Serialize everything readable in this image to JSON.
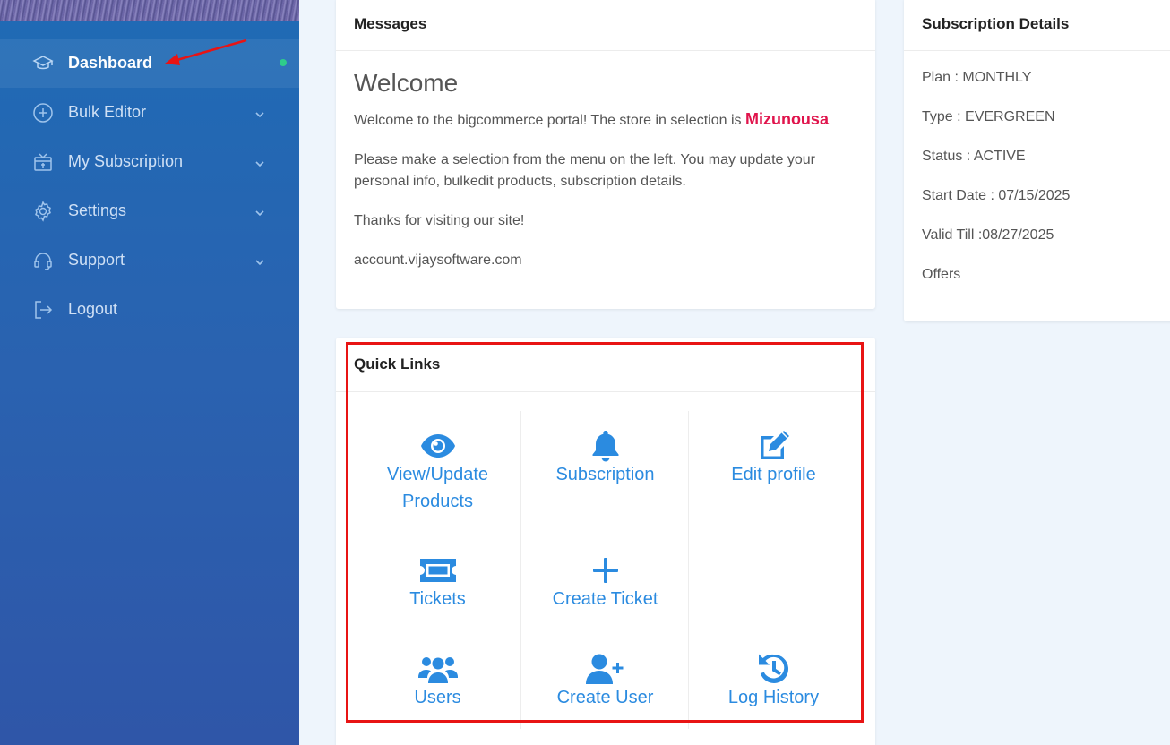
{
  "sidebar": {
    "items": [
      {
        "label": "Dashboard",
        "icon": "graduation-cap-icon",
        "active": true
      },
      {
        "label": "Bulk Editor",
        "icon": "plus-circle-icon"
      },
      {
        "label": "My Subscription",
        "icon": "subscription-box-icon"
      },
      {
        "label": "Settings",
        "icon": "gear-icon"
      },
      {
        "label": "Support",
        "icon": "headset-icon"
      },
      {
        "label": "Logout",
        "icon": "logout-icon"
      }
    ]
  },
  "messages": {
    "title": "Messages",
    "heading": "Welcome",
    "intro": "Welcome to the bigcommerce portal! The store in selection is",
    "store": "Mizunousa",
    "instructions": "Please make a selection from the menu on the left. You may update your personal info, bulkedit products, subscription details.",
    "thanks": "Thanks for visiting our site!",
    "site": "account.vijaysoftware.com"
  },
  "subscription": {
    "title": "Subscription Details",
    "plan": "Plan : MONTHLY",
    "type": "Type : EVERGREEN",
    "status": "Status : ACTIVE",
    "start": "Start Date : 07/15/2025",
    "valid": "Valid Till :08/27/2025",
    "offers": "Offers"
  },
  "quick_links": {
    "title": "Quick Links",
    "items": [
      {
        "label": "View/Update Products",
        "icon": "eye-icon"
      },
      {
        "label": "Subscription",
        "icon": "bell-icon"
      },
      {
        "label": "Edit profile",
        "icon": "edit-icon"
      },
      {
        "label": "Tickets",
        "icon": "ticket-icon"
      },
      {
        "label": "Create Ticket",
        "icon": "plus-icon"
      },
      {
        "label": "Users",
        "icon": "users-icon"
      },
      {
        "label": "Create User",
        "icon": "user-plus-icon"
      },
      {
        "label": "Log History",
        "icon": "history-icon"
      }
    ]
  },
  "colors": {
    "accent": "#2b8be0",
    "store_highlight": "#e0144c",
    "annotation": "#e81414"
  }
}
